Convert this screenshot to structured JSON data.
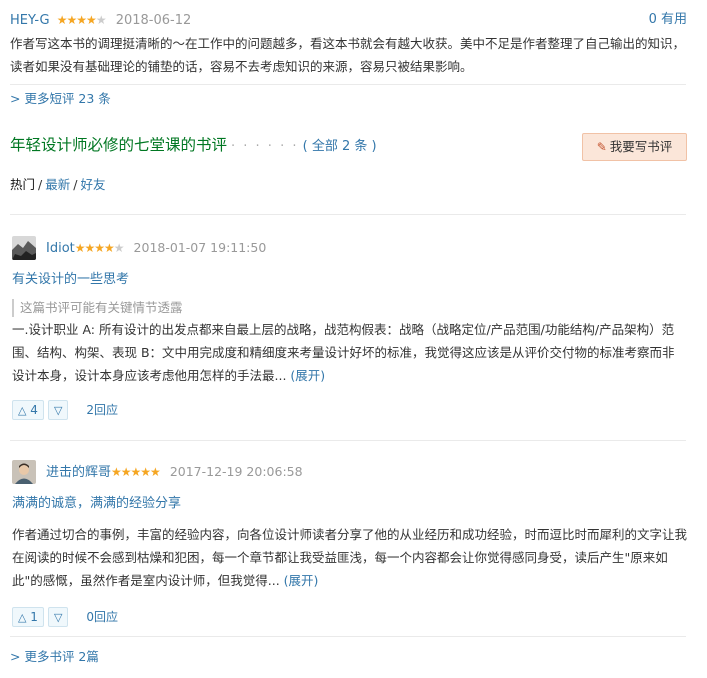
{
  "short_comment": {
    "user": "HEY-G",
    "stars": "★★★★",
    "stars_off": "★",
    "date": "2018-06-12",
    "useful_count": "0",
    "useful_label": "有用",
    "text": "作者写这本书的调理挺清晰的～在工作中的问题越多，看这本书就会有越大收获。美中不足是作者整理了自己输出的知识，读者如果没有基础理论的铺垫的话，容易不去考虑知识的来源，容易只被结果影响。"
  },
  "more_short": "> 更多短评 23 条",
  "reviews_section": {
    "title": "年轻设计师必修的七堂课的书评",
    "dots": "· · · · · ·",
    "all_label": "( 全部 2 条 )",
    "write_button": "我要写书评",
    "filters": [
      "热门",
      "最新",
      "好友"
    ]
  },
  "reviews": [
    {
      "user": "Idiot",
      "stars": "★★★★",
      "stars_off": "★",
      "date": "2018-01-07 19:11:50",
      "title": "有关设计的一些思考",
      "spoiler": "这篇书评可能有关键情节透露",
      "body": "一.设计职业 A: 所有设计的出发点都来自最上层的战略，战范构假表：战略（战略定位/产品范围/功能结构/产品架构）范围、结构、构架、表现 B：文中用完成度和精细度来考量设计好坏的标准，我觉得这应该是从评价交付物的标准考察而非设计本身，设计本身应该考虑他用怎样的手法最...",
      "expand": "(展开)",
      "upvotes": "4",
      "replies": "2回应"
    },
    {
      "user": "进击的辉哥",
      "stars": "★★★★★",
      "stars_off": "",
      "date": "2017-12-19 20:06:58",
      "title": "满满的诚意，满满的经验分享",
      "body": "作者通过切合的事例，丰富的经验内容，向各位设计师读者分享了他的从业经历和成功经验，时而逗比时而犀利的文字让我在阅读的时候不会感到枯燥和犯困，每一个章节都让我受益匪浅，每一个内容都会让你觉得感同身受，读后产生\"原来如此\"的感慨，虽然作者是室内设计师，但我觉得...",
      "expand": "(展开)",
      "upvotes": "1",
      "replies": "0回应"
    }
  ],
  "more_reviews": "> 更多书评 2篇",
  "icons": {
    "pencil": "pencil-icon",
    "upvote": "triangle-up-icon",
    "downvote": "triangle-down-icon"
  },
  "colors": {
    "link": "#3377aa",
    "section_title": "#007722",
    "star": "#f5a623",
    "write_button_bg": "#fbe6d9"
  }
}
